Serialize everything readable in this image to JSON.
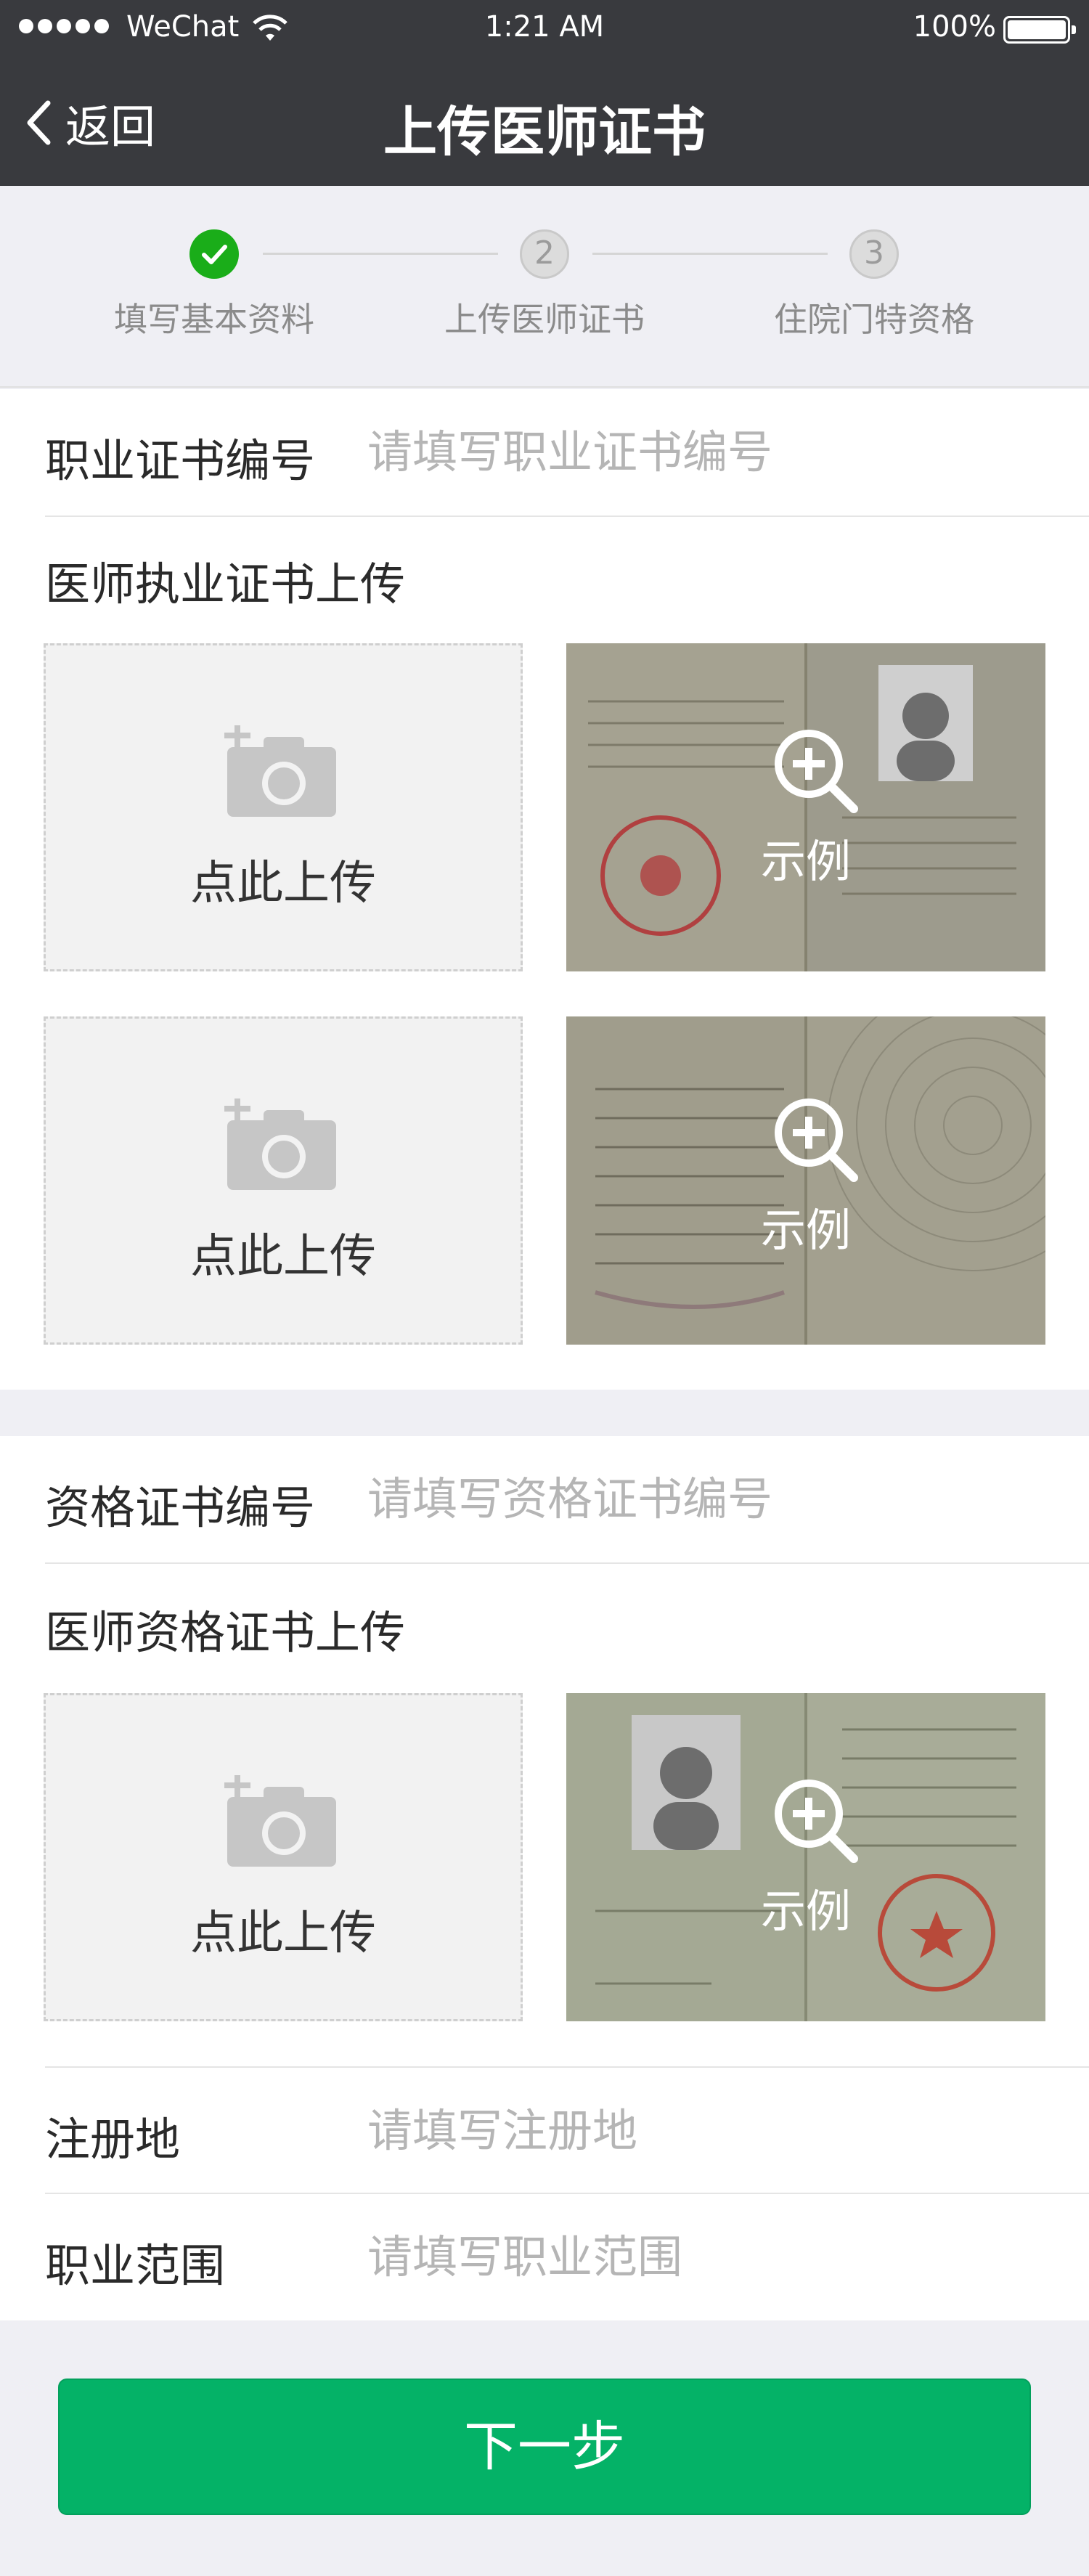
{
  "status_bar": {
    "carrier": "WeChat",
    "time": "1:21 AM",
    "battery": "100%",
    "battery_level": 1.0
  },
  "nav": {
    "back_label": "返回",
    "title": "上传医师证书"
  },
  "steps": [
    {
      "label": "填写基本资料",
      "number": "",
      "state": "done"
    },
    {
      "label": "上传医师证书",
      "number": "2",
      "state": "todo"
    },
    {
      "label": "住院门特资格",
      "number": "3",
      "state": "todo"
    }
  ],
  "practice_cert": {
    "label": "职业证书编号",
    "placeholder": "请填写职业证书编号",
    "upload_title": "医师执业证书上传",
    "upload_label": "点此上传",
    "example_label": "示例"
  },
  "qualification_cert": {
    "label": "资格证书编号",
    "placeholder": "请填写资格证书编号",
    "upload_title": "医师资格证书上传",
    "upload_label": "点此上传",
    "example_label": "示例"
  },
  "registration": {
    "label": "注册地",
    "placeholder": "请填写注册地"
  },
  "scope": {
    "label": "职业范围",
    "placeholder": "请填写职业范围"
  },
  "next_button": "下一步",
  "colors": {
    "nav_bg": "#393a3e",
    "accent_green": "#04b267",
    "step_done": "#1aad19",
    "placeholder": "#b5b5b5"
  },
  "icons": [
    "back-chevron-icon",
    "checkmark-icon",
    "camera-add-icon",
    "zoom-in-icon",
    "wifi-icon",
    "battery-icon"
  ]
}
